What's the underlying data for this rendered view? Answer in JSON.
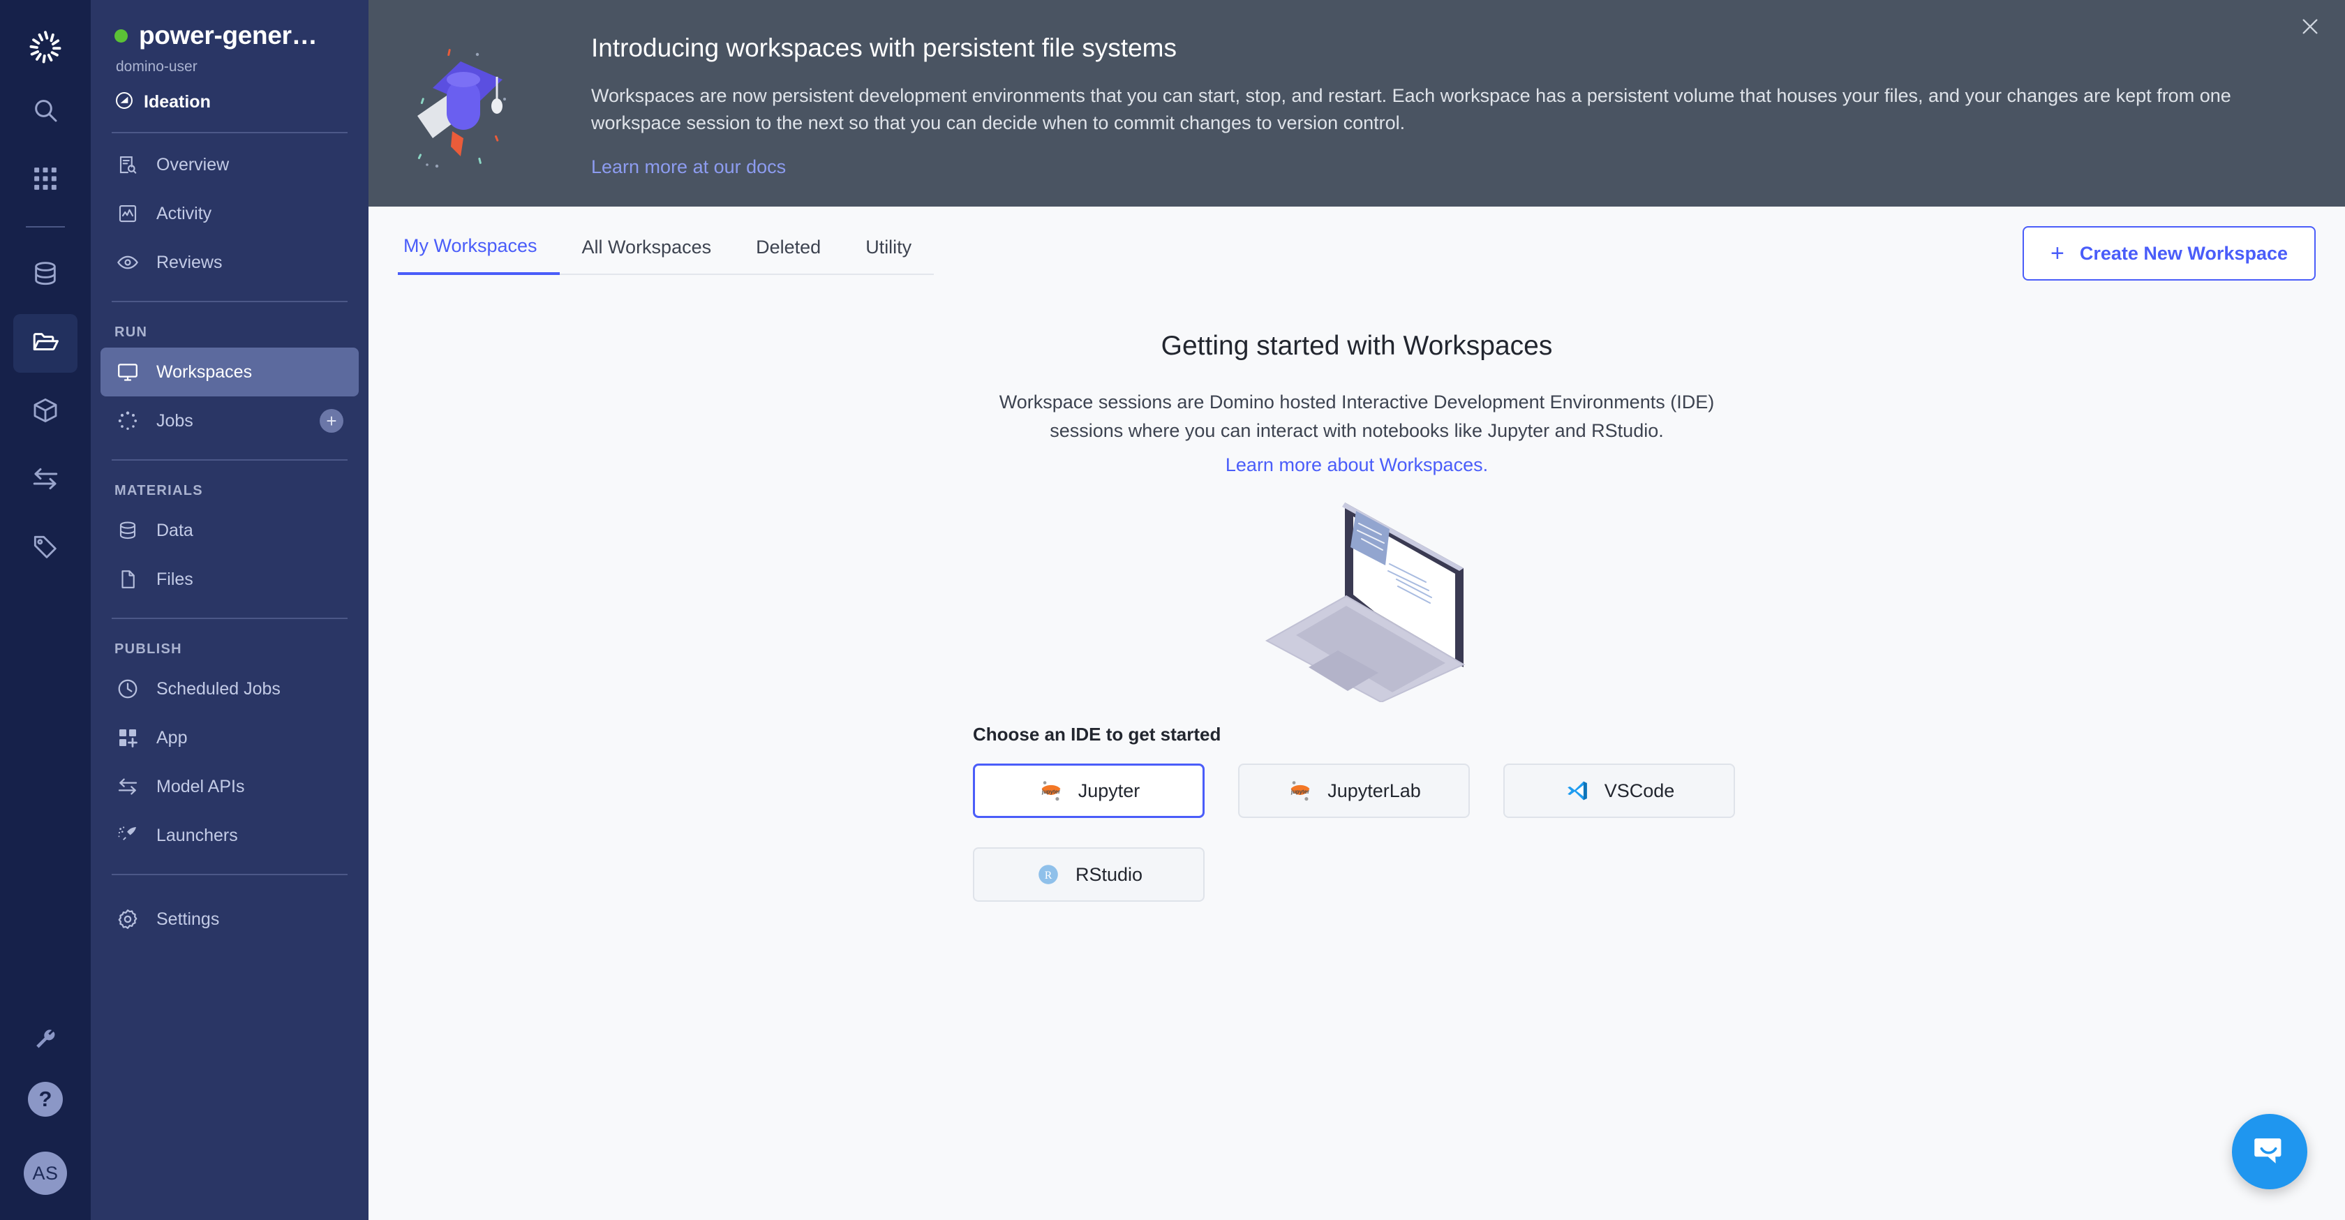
{
  "rail": {
    "logo_icon": "domino-logo-icon",
    "items": [
      {
        "icon": "search-icon",
        "name": "search",
        "active": false
      },
      {
        "icon": "grid-apps-icon",
        "name": "apps",
        "active": false
      },
      {
        "icon": "database-icon",
        "name": "data",
        "active": false
      },
      {
        "icon": "folder-open-icon",
        "name": "projects",
        "active": true
      },
      {
        "icon": "cube-icon",
        "name": "environments",
        "active": false
      },
      {
        "icon": "transfer-arrows-icon",
        "name": "model-apis",
        "active": false
      },
      {
        "icon": "tag-icon",
        "name": "tags",
        "active": false
      }
    ],
    "bottom": [
      {
        "icon": "wrench-icon",
        "name": "admin-tools"
      },
      {
        "icon": "help-icon",
        "name": "help",
        "glyph": "?"
      }
    ],
    "avatar_initials": "AS"
  },
  "sidebar": {
    "project_name": "power-gener…",
    "owner": "domino-user",
    "stage": "Ideation",
    "stage_icon": "stage-circle-icon",
    "status_color": "#5bc236",
    "top_items": [
      {
        "label": "Overview",
        "icon": "overview-icon",
        "active": false
      },
      {
        "label": "Activity",
        "icon": "activity-icon",
        "active": false
      },
      {
        "label": "Reviews",
        "icon": "eye-icon",
        "active": false
      }
    ],
    "sections": [
      {
        "label": "RUN",
        "items": [
          {
            "label": "Workspaces",
            "icon": "monitor-icon",
            "active": true,
            "add": false
          },
          {
            "label": "Jobs",
            "icon": "jobs-spinner-icon",
            "active": false,
            "add": true,
            "add_label": "+"
          }
        ]
      },
      {
        "label": "MATERIALS",
        "items": [
          {
            "label": "Data",
            "icon": "database-icon",
            "active": false,
            "add": false
          },
          {
            "label": "Files",
            "icon": "file-icon",
            "active": false,
            "add": false
          }
        ]
      },
      {
        "label": "PUBLISH",
        "items": [
          {
            "label": "Scheduled Jobs",
            "icon": "clock-icon",
            "active": false,
            "add": false
          },
          {
            "label": "App",
            "icon": "app-grid-icon",
            "active": false,
            "add": false
          },
          {
            "label": "Model APIs",
            "icon": "transfer-arrows-icon",
            "active": false,
            "add": false
          },
          {
            "label": "Launchers",
            "icon": "rocket-icon",
            "active": false,
            "add": false
          }
        ]
      }
    ],
    "settings": {
      "label": "Settings",
      "icon": "gear-icon"
    }
  },
  "banner": {
    "title": "Introducing workspaces with persistent file systems",
    "body": "Workspaces are now persistent development environments that you can start, stop, and restart. Each workspace has a persistent volume that houses your files, and your changes are kept from one workspace session to the next so that you can decide when to commit changes to version control.",
    "link": "Learn more at our docs",
    "close_icon": "close-icon",
    "illustration": "graduation-cap-icon",
    "bg_color": "#4a5462",
    "link_color": "#8d9cf0"
  },
  "tabs": [
    {
      "label": "My Workspaces",
      "active": true
    },
    {
      "label": "All Workspaces",
      "active": false
    },
    {
      "label": "Deleted",
      "active": false
    },
    {
      "label": "Utility",
      "active": false
    }
  ],
  "create_button": {
    "label": "Create New Workspace",
    "plus": "+",
    "icon": "plus-icon",
    "color": "#4a5df9"
  },
  "getting_started": {
    "title": "Getting started with Workspaces",
    "description": "Workspace sessions are Domino hosted Interactive Development Environments (IDE) sessions where you can interact with notebooks like Jupyter and RStudio.",
    "link": "Learn more about Workspaces.",
    "illustration": "laptop-illustration"
  },
  "ide": {
    "label": "Choose an IDE to get started",
    "options": [
      {
        "label": "Jupyter",
        "icon": "jupyter-icon",
        "selected": true
      },
      {
        "label": "JupyterLab",
        "icon": "jupyter-icon",
        "selected": false
      },
      {
        "label": "VSCode",
        "icon": "vscode-icon",
        "selected": false
      },
      {
        "label": "RStudio",
        "icon": "rstudio-icon",
        "selected": false
      }
    ]
  },
  "intercom": {
    "icon": "chat-bubble-icon",
    "color": "#1f96ef"
  }
}
